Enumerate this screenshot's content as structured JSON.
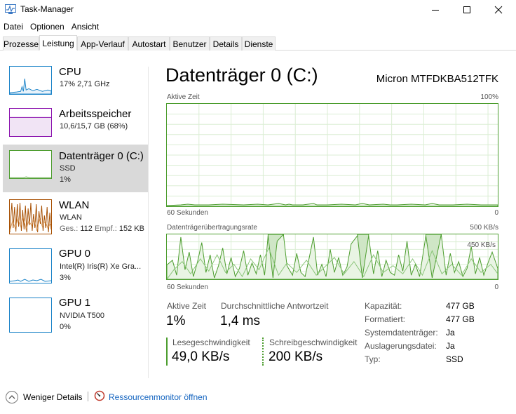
{
  "window": {
    "title": "Task-Manager"
  },
  "menu": [
    "Datei",
    "Optionen",
    "Ansicht"
  ],
  "tabs": [
    "Prozesse",
    "Leistung",
    "App-Verlauf",
    "Autostart",
    "Benutzer",
    "Details",
    "Dienste"
  ],
  "active_tab": "Leistung",
  "sidebar": [
    {
      "name": "CPU",
      "line1": "17%  2,71 GHz",
      "line2": "",
      "color": "#1a83c8"
    },
    {
      "name": "Arbeitsspeicher",
      "line1": "10,6/15,7 GB (68%)",
      "line2": "",
      "color": "#8b12ae"
    },
    {
      "name": "Datenträger 0 (C:)",
      "line1": "SSD",
      "line2": "1%",
      "color": "#4c9d2e"
    },
    {
      "name": "WLAN",
      "line1": "WLAN",
      "line2_prefix_a": "Ges.:",
      "line2_value_a": "112",
      "line2_prefix_b": "Empf.:",
      "line2_value_b": "152 KB",
      "color": "#a74f01"
    },
    {
      "name": "GPU 0",
      "line1": "Intel(R) Iris(R) Xe Gra...",
      "line2": "3%",
      "color": "#1a83c8"
    },
    {
      "name": "GPU 1",
      "line1": "NVIDIA T500",
      "line2": "0%",
      "color": "#1a83c8"
    }
  ],
  "main": {
    "title": "Datenträger 0 (C:)",
    "model": "Micron MTFDKBA512TFK",
    "graph1": {
      "label": "Aktive Zeit",
      "max_label": "100%",
      "time_label": "60 Sekunden",
      "min_label": "0"
    },
    "graph2": {
      "label": "Datenträgerübertragungsrate",
      "max_label": "500 KB/s",
      "mark_label": "450 KB/s",
      "time_label": "60 Sekunden",
      "min_label": "0"
    },
    "stats": {
      "active_time_label": "Aktive Zeit",
      "active_time_value": "1%",
      "response_label": "Durchschnittliche Antwortzeit",
      "response_value": "1,4 ms",
      "read_label": "Lesegeschwindigkeit",
      "read_value": "49,0 KB/s",
      "write_label": "Schreibgeschwindigkeit",
      "write_value": "200 KB/s"
    },
    "properties": [
      {
        "label": "Kapazität:",
        "value": "477 GB"
      },
      {
        "label": "Formatiert:",
        "value": "477 GB"
      },
      {
        "label": "Systemdatenträger:",
        "value": "Ja"
      },
      {
        "label": "Auslagerungsdatei:",
        "value": "Ja"
      },
      {
        "label": "Typ:",
        "value": "SSD"
      }
    ]
  },
  "footer": {
    "less_details": "Weniger Details",
    "resource_monitor": "Ressourcenmonitor öffnen"
  },
  "colors": {
    "disk": "#4c9d2e",
    "cpu": "#1a83c8",
    "memory": "#8b12ae",
    "wlan": "#a74f01",
    "link": "#1565c0"
  }
}
